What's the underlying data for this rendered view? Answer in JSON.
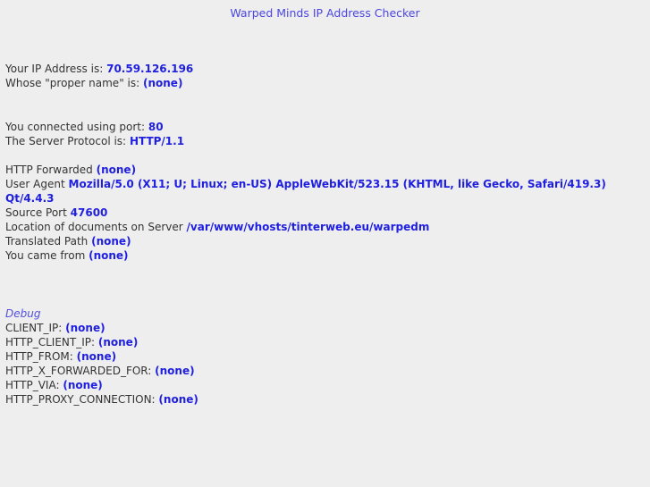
{
  "page": {
    "title": "Warped Minds IP Address Checker",
    "background_color": "#eeeeee",
    "label_color": "#333333",
    "value_color": "#1f1fe0",
    "title_color": "#4a46e0",
    "debug_heading_color": "#5250dd"
  },
  "identity": [
    {
      "label": "Your IP Address is:",
      "value": "70.59.126.196"
    },
    {
      "label": "Whose \"proper name\" is:",
      "value": "(none)"
    }
  ],
  "connection": [
    {
      "label": "You connected using port:",
      "value": "80"
    },
    {
      "label": "The Server Protocol is:",
      "value": "HTTP/1.1"
    }
  ],
  "request": [
    {
      "label": "HTTP Forwarded",
      "value": "(none)"
    },
    {
      "label": "User Agent",
      "value": "Mozilla/5.0 (X11; U; Linux; en-US) AppleWebKit/523.15 (KHTML, like Gecko, Safari/419.3) Qt/4.4.3"
    },
    {
      "label": "Source Port",
      "value": "47600"
    },
    {
      "label": "Location of documents on Server",
      "value": "/var/www/vhosts/tinterweb.eu/warpedm"
    },
    {
      "label": "Translated Path",
      "value": "(none)"
    },
    {
      "label": "You came from",
      "value": "(none)"
    }
  ],
  "debug": {
    "heading": "Debug",
    "entries": [
      {
        "label": "CLIENT_IP:",
        "value": "(none)"
      },
      {
        "label": "HTTP_CLIENT_IP:",
        "value": "(none)"
      },
      {
        "label": "HTTP_FROM:",
        "value": "(none)"
      },
      {
        "label": "HTTP_X_FORWARDED_FOR:",
        "value": "(none)"
      },
      {
        "label": "HTTP_VIA:",
        "value": "(none)"
      },
      {
        "label": "HTTP_PROXY_CONNECTION:",
        "value": "(none)"
      }
    ]
  }
}
